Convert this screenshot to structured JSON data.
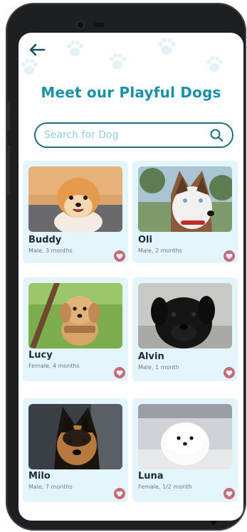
{
  "header": {
    "title": "Meet our Playful Dogs"
  },
  "search": {
    "placeholder": "Search for Dog"
  },
  "icons": {
    "back": "arrow-left-icon",
    "search": "search-icon",
    "favorite": "heart-icon",
    "decoration": "paw-print-icon"
  },
  "colors": {
    "accent": "#1a91a7",
    "search_border": "#1d6e80",
    "card_bg": "#e3f5fb",
    "favorite": "#c46a78"
  },
  "dogs": [
    {
      "name": "Buddy",
      "details": "Male, 3 months"
    },
    {
      "name": "Oli",
      "details": "Male, 2 months"
    },
    {
      "name": "Lucy",
      "details": "Female, 4 months"
    },
    {
      "name": "Alvin",
      "details": "Male, 1 month"
    },
    {
      "name": "Milo",
      "details": "Male, 7 months"
    },
    {
      "name": "Luna",
      "details": "Female, 1/2 month"
    }
  ]
}
